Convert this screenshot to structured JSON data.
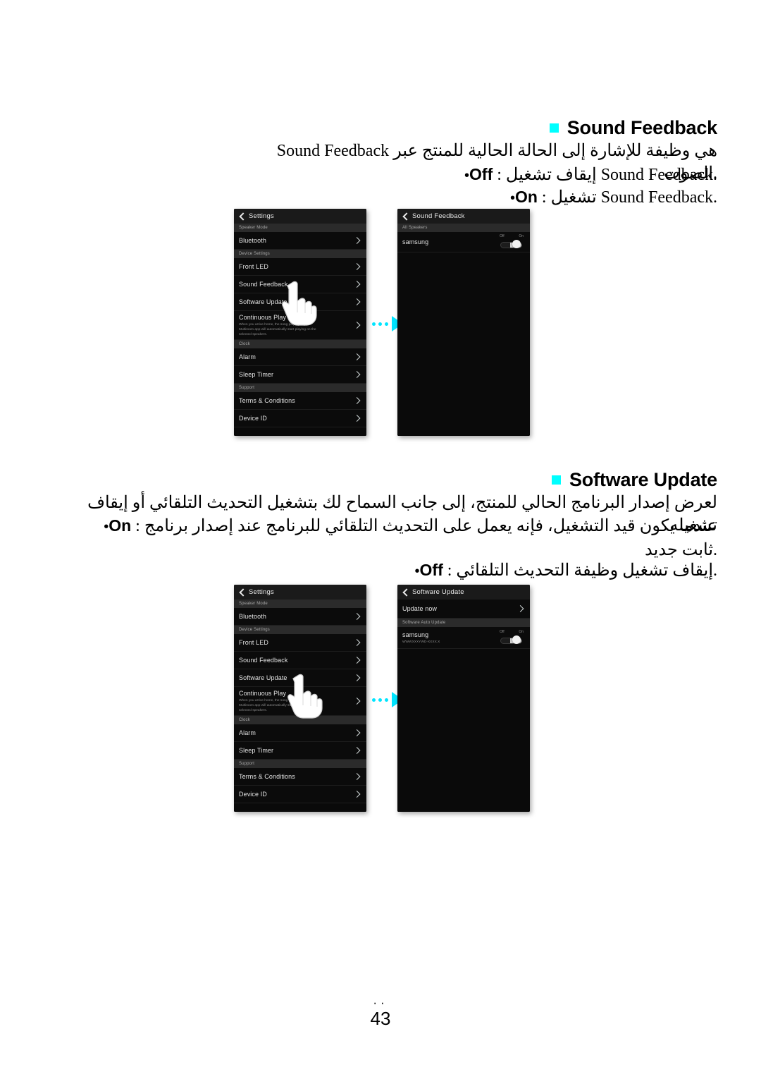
{
  "page": {
    "number": "43",
    "dots": "··"
  },
  "sections": [
    {
      "heading": "Sound Feedback",
      "bullet_color": "#00ffff",
      "description": "Sound Feedback هي وظيفة للإشارة إلى الحالة الحالية للمنتج عبر الصوت.",
      "options": [
        {
          "label": "Off",
          "text": ": إيقاف تشغيل Sound Feedback."
        },
        {
          "label": "On",
          "text": ": تشغيل Sound Feedback."
        }
      ]
    },
    {
      "heading": "Software Update",
      "bullet_color": "#00ffff",
      "description": "لعرض إصدار البرنامج الحالي للمنتج، إلى جانب السماح لك بتشغيل التحديث التلقائي أو إيقاف تشغيله.",
      "options": [
        {
          "label": "On",
          "text": ": عندما يكون قيد التشغيل، فإنه يعمل على التحديث التلقائي للبرنامج عند إصدار برنامج ثابت جديد."
        },
        {
          "label": "Off",
          "text": ": إيقاف تشغيل وظيفة التحديث التلقائي."
        }
      ]
    }
  ],
  "settings_screen": {
    "title": "Settings",
    "groups": [
      {
        "header": "Speaker Mode",
        "rows": [
          {
            "label": "Bluetooth"
          }
        ]
      },
      {
        "header": "Device Settings",
        "rows": [
          {
            "label": "Front LED"
          },
          {
            "label": "Sound Feedback"
          },
          {
            "label": "Software Update"
          },
          {
            "label": "Continuous Play",
            "sub": "When you arrive home, the song playing in your Multiroom app will automatically start playing on the selected speakers."
          }
        ]
      },
      {
        "header": "Clock",
        "rows": [
          {
            "label": "Alarm"
          },
          {
            "label": "Sleep Timer"
          }
        ]
      },
      {
        "header": "Support",
        "rows": [
          {
            "label": "Terms & Conditions"
          },
          {
            "label": "Device ID"
          }
        ]
      }
    ]
  },
  "sound_feedback_screen": {
    "title": "Sound Feedback",
    "group_header": "All Speakers",
    "device": "samsung",
    "toggle": {
      "off_label": "Off",
      "on_label": "On",
      "state": "On"
    }
  },
  "software_update_screen": {
    "title": "Software Update",
    "update_now": "Update now",
    "group_header": "Software Auto Update",
    "device": "samsung",
    "version": "WWWXXXYWD-XXXX.X",
    "toggle": {
      "off_label": "Off",
      "on_label": "On",
      "state": "On"
    }
  },
  "flow": {
    "arrow_color": "#00e5ff",
    "dots": 3
  }
}
